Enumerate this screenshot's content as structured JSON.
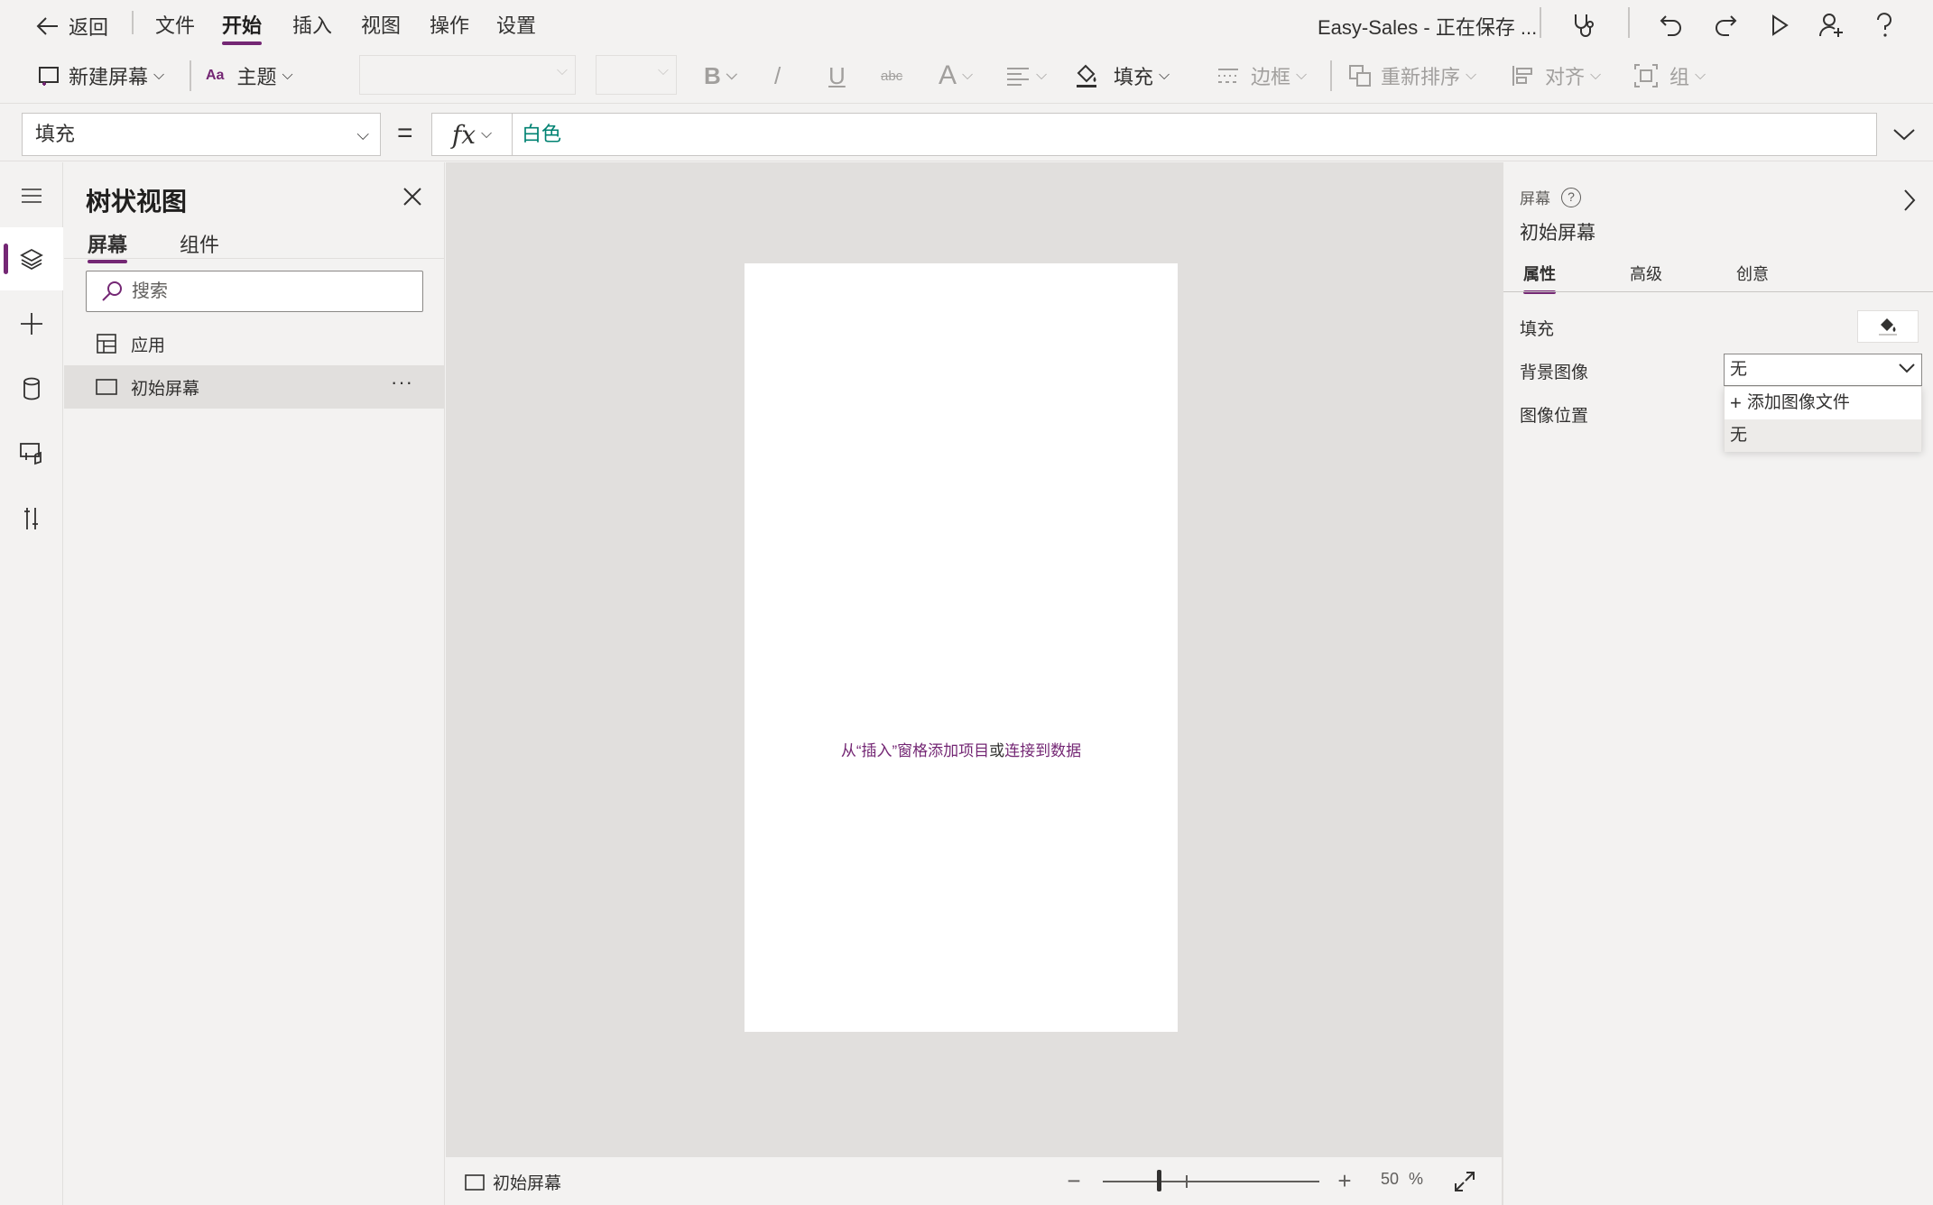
{
  "menubar": {
    "back_label": "返回",
    "items": [
      "文件",
      "开始",
      "插入",
      "视图",
      "操作",
      "设置"
    ],
    "active_item": "开始",
    "app_status": "Easy-Sales - 正在保存 ..."
  },
  "ribbon": {
    "new_screen": "新建屏幕",
    "theme": "主题",
    "bold": "B",
    "italic": "/",
    "underline": "U",
    "strike": "abc",
    "font_color": "A",
    "fill": "填充",
    "border": "边框",
    "reorder": "重新排序",
    "align": "对齐",
    "group": "组"
  },
  "formulabar": {
    "property": "填充",
    "equals": "=",
    "fx": "fx",
    "formula": "白色"
  },
  "tree": {
    "title": "树状视图",
    "tabs": [
      "屏幕",
      "组件"
    ],
    "active_tab": "屏幕",
    "search_placeholder": "搜索",
    "items": [
      {
        "label": "应用",
        "icon": "app-icon"
      },
      {
        "label": "初始屏幕",
        "icon": "screen-icon",
        "selected": true,
        "more": "···"
      }
    ]
  },
  "canvas": {
    "hint_part1": "从“插入”窗格添加项目",
    "hint_or": "或",
    "hint_link": "连接到数据"
  },
  "statusbar": {
    "screen_name": "初始屏幕",
    "zoom_value": "50",
    "zoom_unit": "%"
  },
  "props": {
    "type_label": "屏幕",
    "help": "?",
    "name": "初始屏幕",
    "tabs": [
      "属性",
      "高级",
      "创意"
    ],
    "active_tab": "属性",
    "fill_label": "填充",
    "bg_image_label": "背景图像",
    "image_position_label": "图像位置",
    "bg_image_value": "无",
    "dropdown_options": [
      "添加图像文件",
      "无"
    ],
    "dropdown_add_prefix": "+"
  },
  "colors": {
    "accent": "#742774",
    "formula_text": "#008272",
    "canvas_bg": "#e1dfdd",
    "panel_bg": "#f3f2f1"
  }
}
